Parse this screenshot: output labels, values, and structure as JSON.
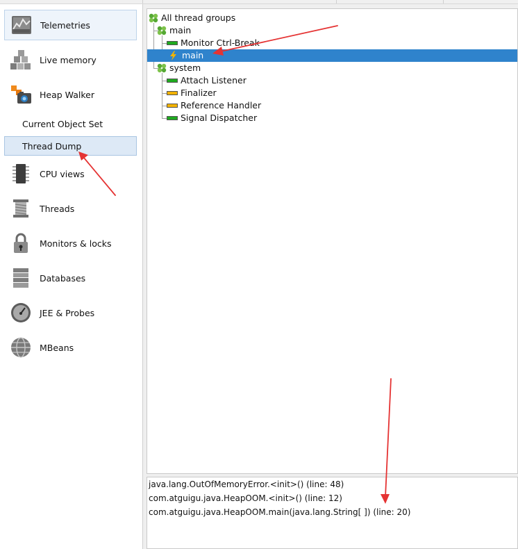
{
  "sidebar": {
    "items": [
      {
        "label": "Telemetries",
        "icon": "telemetries-icon"
      },
      {
        "label": "Live memory",
        "icon": "live-memory-icon"
      },
      {
        "label": "Heap Walker",
        "icon": "heap-walker-icon"
      },
      {
        "label": "CPU views",
        "icon": "cpu-views-icon"
      },
      {
        "label": "Threads",
        "icon": "threads-icon"
      },
      {
        "label": "Monitors & locks",
        "icon": "lock-icon"
      },
      {
        "label": "Databases",
        "icon": "databases-icon"
      },
      {
        "label": "JEE & Probes",
        "icon": "gauge-icon"
      },
      {
        "label": "MBeans",
        "icon": "globe-icon"
      }
    ],
    "subitems": [
      {
        "label": "Current Object Set"
      },
      {
        "label": "Thread Dump"
      }
    ]
  },
  "thread_tree": {
    "root": "All thread groups",
    "groups": [
      {
        "label": "main",
        "threads": [
          {
            "label": "Monitor Ctrl-Break",
            "state": "green"
          },
          {
            "label": "main",
            "state": "lightning"
          }
        ]
      },
      {
        "label": "system",
        "threads": [
          {
            "label": "Attach Listener",
            "state": "green"
          },
          {
            "label": "Finalizer",
            "state": "yellow"
          },
          {
            "label": "Reference Handler",
            "state": "yellow"
          },
          {
            "label": "Signal Dispatcher",
            "state": "green"
          }
        ]
      }
    ],
    "selected": "main"
  },
  "stack_trace": [
    "java.lang.OutOfMemoryError.<init>() (line: 48)",
    "com.atguigu.java.HeapOOM.<init>() (line: 12)",
    "com.atguigu.java.HeapOOM.main(java.lang.String[ ]) (line: 20)"
  ],
  "colors": {
    "selection": "#2f83cc",
    "running": "#1faa1f",
    "waiting": "#f2b200",
    "annotation_arrow": "#e53333"
  }
}
